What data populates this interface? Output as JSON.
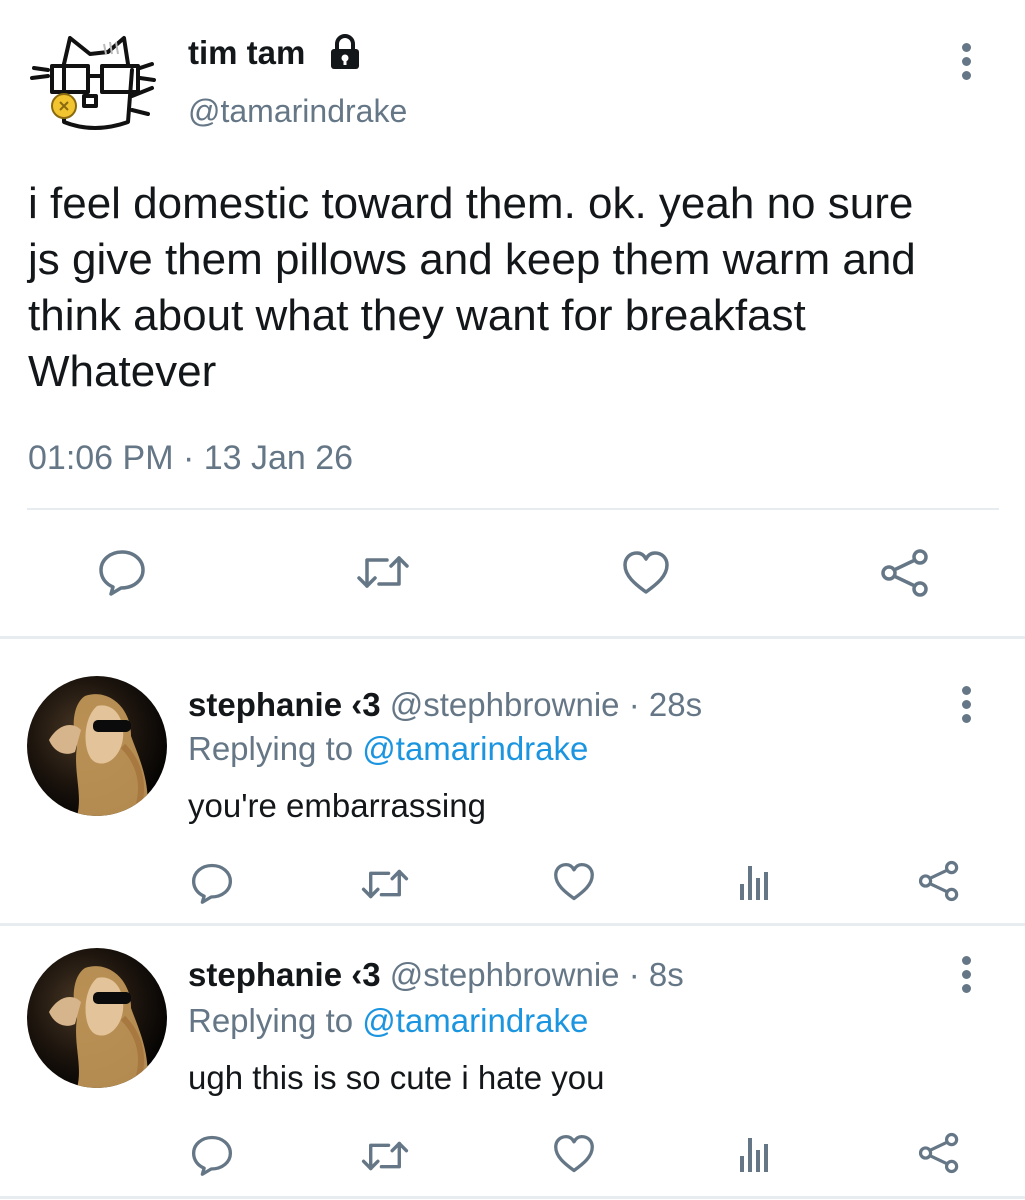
{
  "main_tweet": {
    "display_name": "tim tam",
    "handle": "@tamarindrake",
    "text_lines": [
      "i feel domestic toward them. ok. yeah no sure",
      "js give them pillows and keep them warm and",
      "think about what they want for breakfast",
      "Whatever"
    ],
    "timestamp": "01:06 PM · 13 Jan 26",
    "icons": {
      "lock": "lock-icon",
      "more": "more-options-icon",
      "reply": "reply-icon",
      "retweet": "retweet-icon",
      "like": "heart-icon",
      "share": "share-icon"
    }
  },
  "replies": [
    {
      "display_name": "stephanie ‹3",
      "handle": "@stephbrownie",
      "time": "· 28s",
      "replying_prefix": "Replying to",
      "replying_to": "@tamarindrake",
      "text": "you're embarrassing"
    },
    {
      "display_name": "stephanie ‹3",
      "handle": "@stephbrownie",
      "time": "· 8s",
      "replying_prefix": "Replying to",
      "replying_to": "@tamarindrake",
      "text": "ugh this is so cute i hate you"
    }
  ],
  "colors": {
    "text": "#14171a",
    "muted": "#657786",
    "link": "#1b95e0",
    "divider": "#e6ecf0"
  }
}
